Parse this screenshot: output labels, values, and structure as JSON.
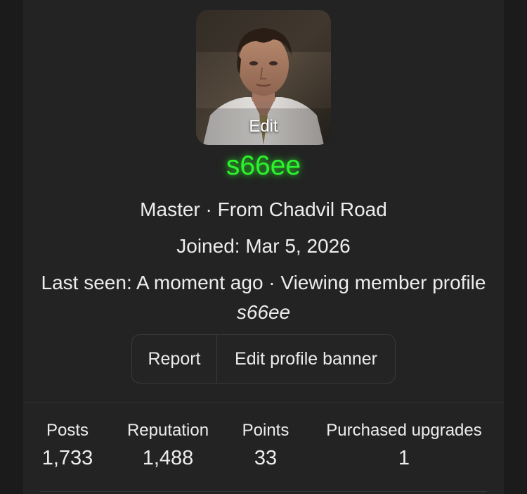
{
  "profile": {
    "avatar_edit_label": "Edit",
    "username": "s66ee",
    "username_color": "#2ef22e",
    "title_line": "Master · From Chadvil Road",
    "joined_line": "Joined: Mar 5, 2026",
    "last_seen_prefix": "Last seen: A moment ago · Viewing member profile",
    "last_seen_target": "s66ee"
  },
  "actions": {
    "report_label": "Report",
    "edit_banner_label": "Edit profile banner"
  },
  "stats": {
    "posts_label": "Posts",
    "posts_value": "1,733",
    "reputation_label": "Reputation",
    "reputation_value": "1,488",
    "points_label": "Points",
    "points_value": "33",
    "upgrades_label": "Purchased upgrades",
    "upgrades_value": "1"
  }
}
